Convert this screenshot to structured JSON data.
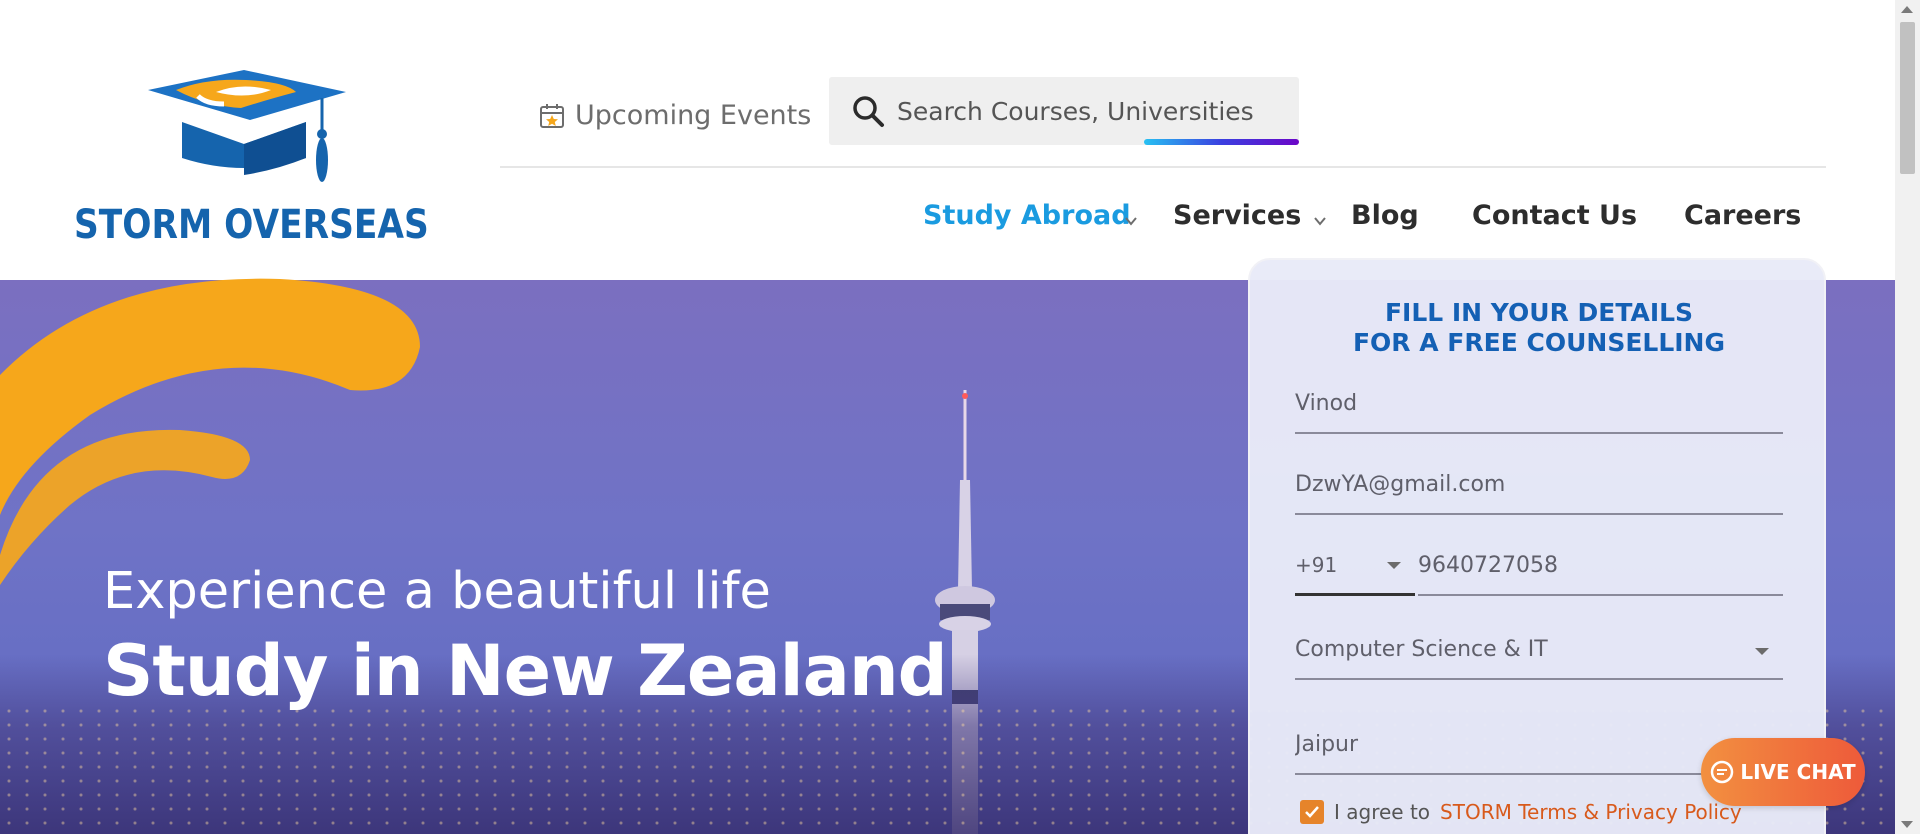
{
  "brand": {
    "name": "STORM OVERSEAS",
    "colors": {
      "primary": "#1564ad",
      "accent": "#f6a71b",
      "nav_active": "#1a9be0",
      "cta": "#ee5a3a"
    }
  },
  "header": {
    "events_label": "Upcoming Events",
    "search_placeholder": "Search Courses, Universities",
    "nav": [
      {
        "label": "Study Abroad",
        "active": true,
        "has_dropdown": true
      },
      {
        "label": "Services",
        "active": false,
        "has_dropdown": true
      },
      {
        "label": "Blog",
        "active": false,
        "has_dropdown": false
      },
      {
        "label": "Contact Us",
        "active": false,
        "has_dropdown": false
      },
      {
        "label": "Careers",
        "active": false,
        "has_dropdown": false
      }
    ]
  },
  "hero": {
    "subtitle": "Experience a beautiful life",
    "title": "Study in New Zealand"
  },
  "form": {
    "title_line1": "FILL IN YOUR DETAILS",
    "title_line2": "FOR A FREE COUNSELLING",
    "name_value": "Vinod",
    "email_value": "DzwYA@gmail.com",
    "phone_code": "+91",
    "phone_value": "9640727058",
    "course_value": "Computer Science & IT",
    "city_value": "Jaipur",
    "agree_text": "I agree to",
    "agree_link": "STORM Terms & Privacy Policy",
    "agree_checked": true
  },
  "live_chat": {
    "label": "LIVE CHAT"
  }
}
